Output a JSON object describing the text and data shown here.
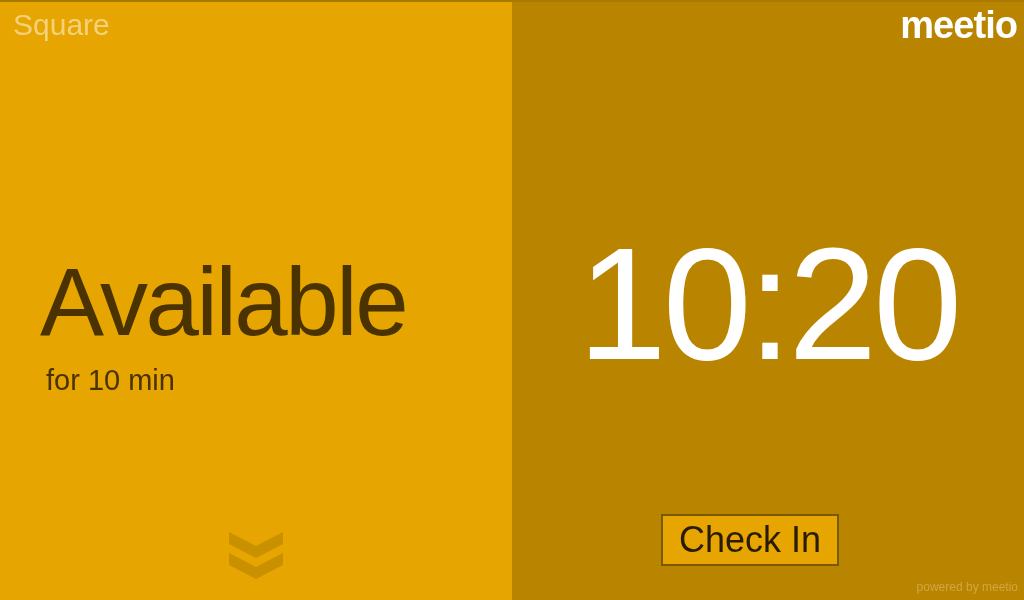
{
  "room": {
    "name": "Square"
  },
  "status": {
    "label": "Available",
    "detail": "for 10 min"
  },
  "clock": {
    "time": "10:20"
  },
  "brand": {
    "logo": "meetio",
    "footer": "powered by meetio"
  },
  "buttons": [
    {
      "label": "Check In"
    }
  ]
}
